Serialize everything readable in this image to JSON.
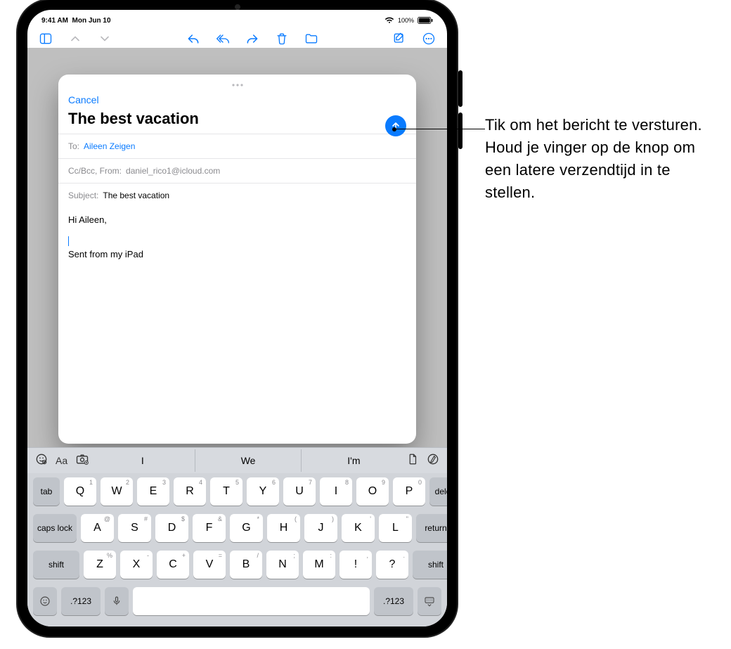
{
  "status": {
    "time": "9:41 AM",
    "date": "Mon Jun 10",
    "battery": "100%"
  },
  "toolbar": {
    "icons": [
      "sidebar",
      "chev-up",
      "chev-down",
      "reply",
      "reply-all",
      "forward",
      "trash",
      "folder",
      "compose",
      "more"
    ]
  },
  "compose": {
    "cancel": "Cancel",
    "title": "The best vacation",
    "to_label": "To:",
    "to_value": "Aileen Zeigen",
    "cc_label": "Cc/Bcc, From:",
    "cc_value": "daniel_rico1@icloud.com",
    "subject_label": "Subject:",
    "subject_value": "The best vacation",
    "body_greeting": "Hi Aileen,",
    "body_signature": "Sent from my iPad"
  },
  "keyboard": {
    "suggestions": [
      "I",
      "We",
      "I'm"
    ],
    "row1": [
      {
        "k": "Q",
        "s": "1"
      },
      {
        "k": "W",
        "s": "2"
      },
      {
        "k": "E",
        "s": "3"
      },
      {
        "k": "R",
        "s": "4"
      },
      {
        "k": "T",
        "s": "5"
      },
      {
        "k": "Y",
        "s": "6"
      },
      {
        "k": "U",
        "s": "7"
      },
      {
        "k": "I",
        "s": "8"
      },
      {
        "k": "O",
        "s": "9"
      },
      {
        "k": "P",
        "s": "0"
      }
    ],
    "row2": [
      {
        "k": "A",
        "s": "@"
      },
      {
        "k": "S",
        "s": "#"
      },
      {
        "k": "D",
        "s": "$"
      },
      {
        "k": "F",
        "s": "&"
      },
      {
        "k": "G",
        "s": "*"
      },
      {
        "k": "H",
        "s": "("
      },
      {
        "k": "J",
        "s": ")"
      },
      {
        "k": "K",
        "s": "'"
      },
      {
        "k": "L",
        "s": "\""
      }
    ],
    "row3": [
      {
        "k": "Z",
        "s": "%"
      },
      {
        "k": "X",
        "s": "-"
      },
      {
        "k": "C",
        "s": "+"
      },
      {
        "k": "V",
        "s": "="
      },
      {
        "k": "B",
        "s": "/"
      },
      {
        "k": "N",
        "s": ";"
      },
      {
        "k": "M",
        "s": ":"
      },
      {
        "k": "!",
        "s": ","
      },
      {
        "k": "?",
        "s": "."
      }
    ],
    "labels": {
      "tab": "tab",
      "delete": "delete",
      "caps": "caps lock",
      "return": "return",
      "shift": "shift",
      "sym": ".?123"
    }
  },
  "callout": "Tik om het bericht te versturen. Houd je vinger op de knop om een latere verzendtijd in te stellen."
}
